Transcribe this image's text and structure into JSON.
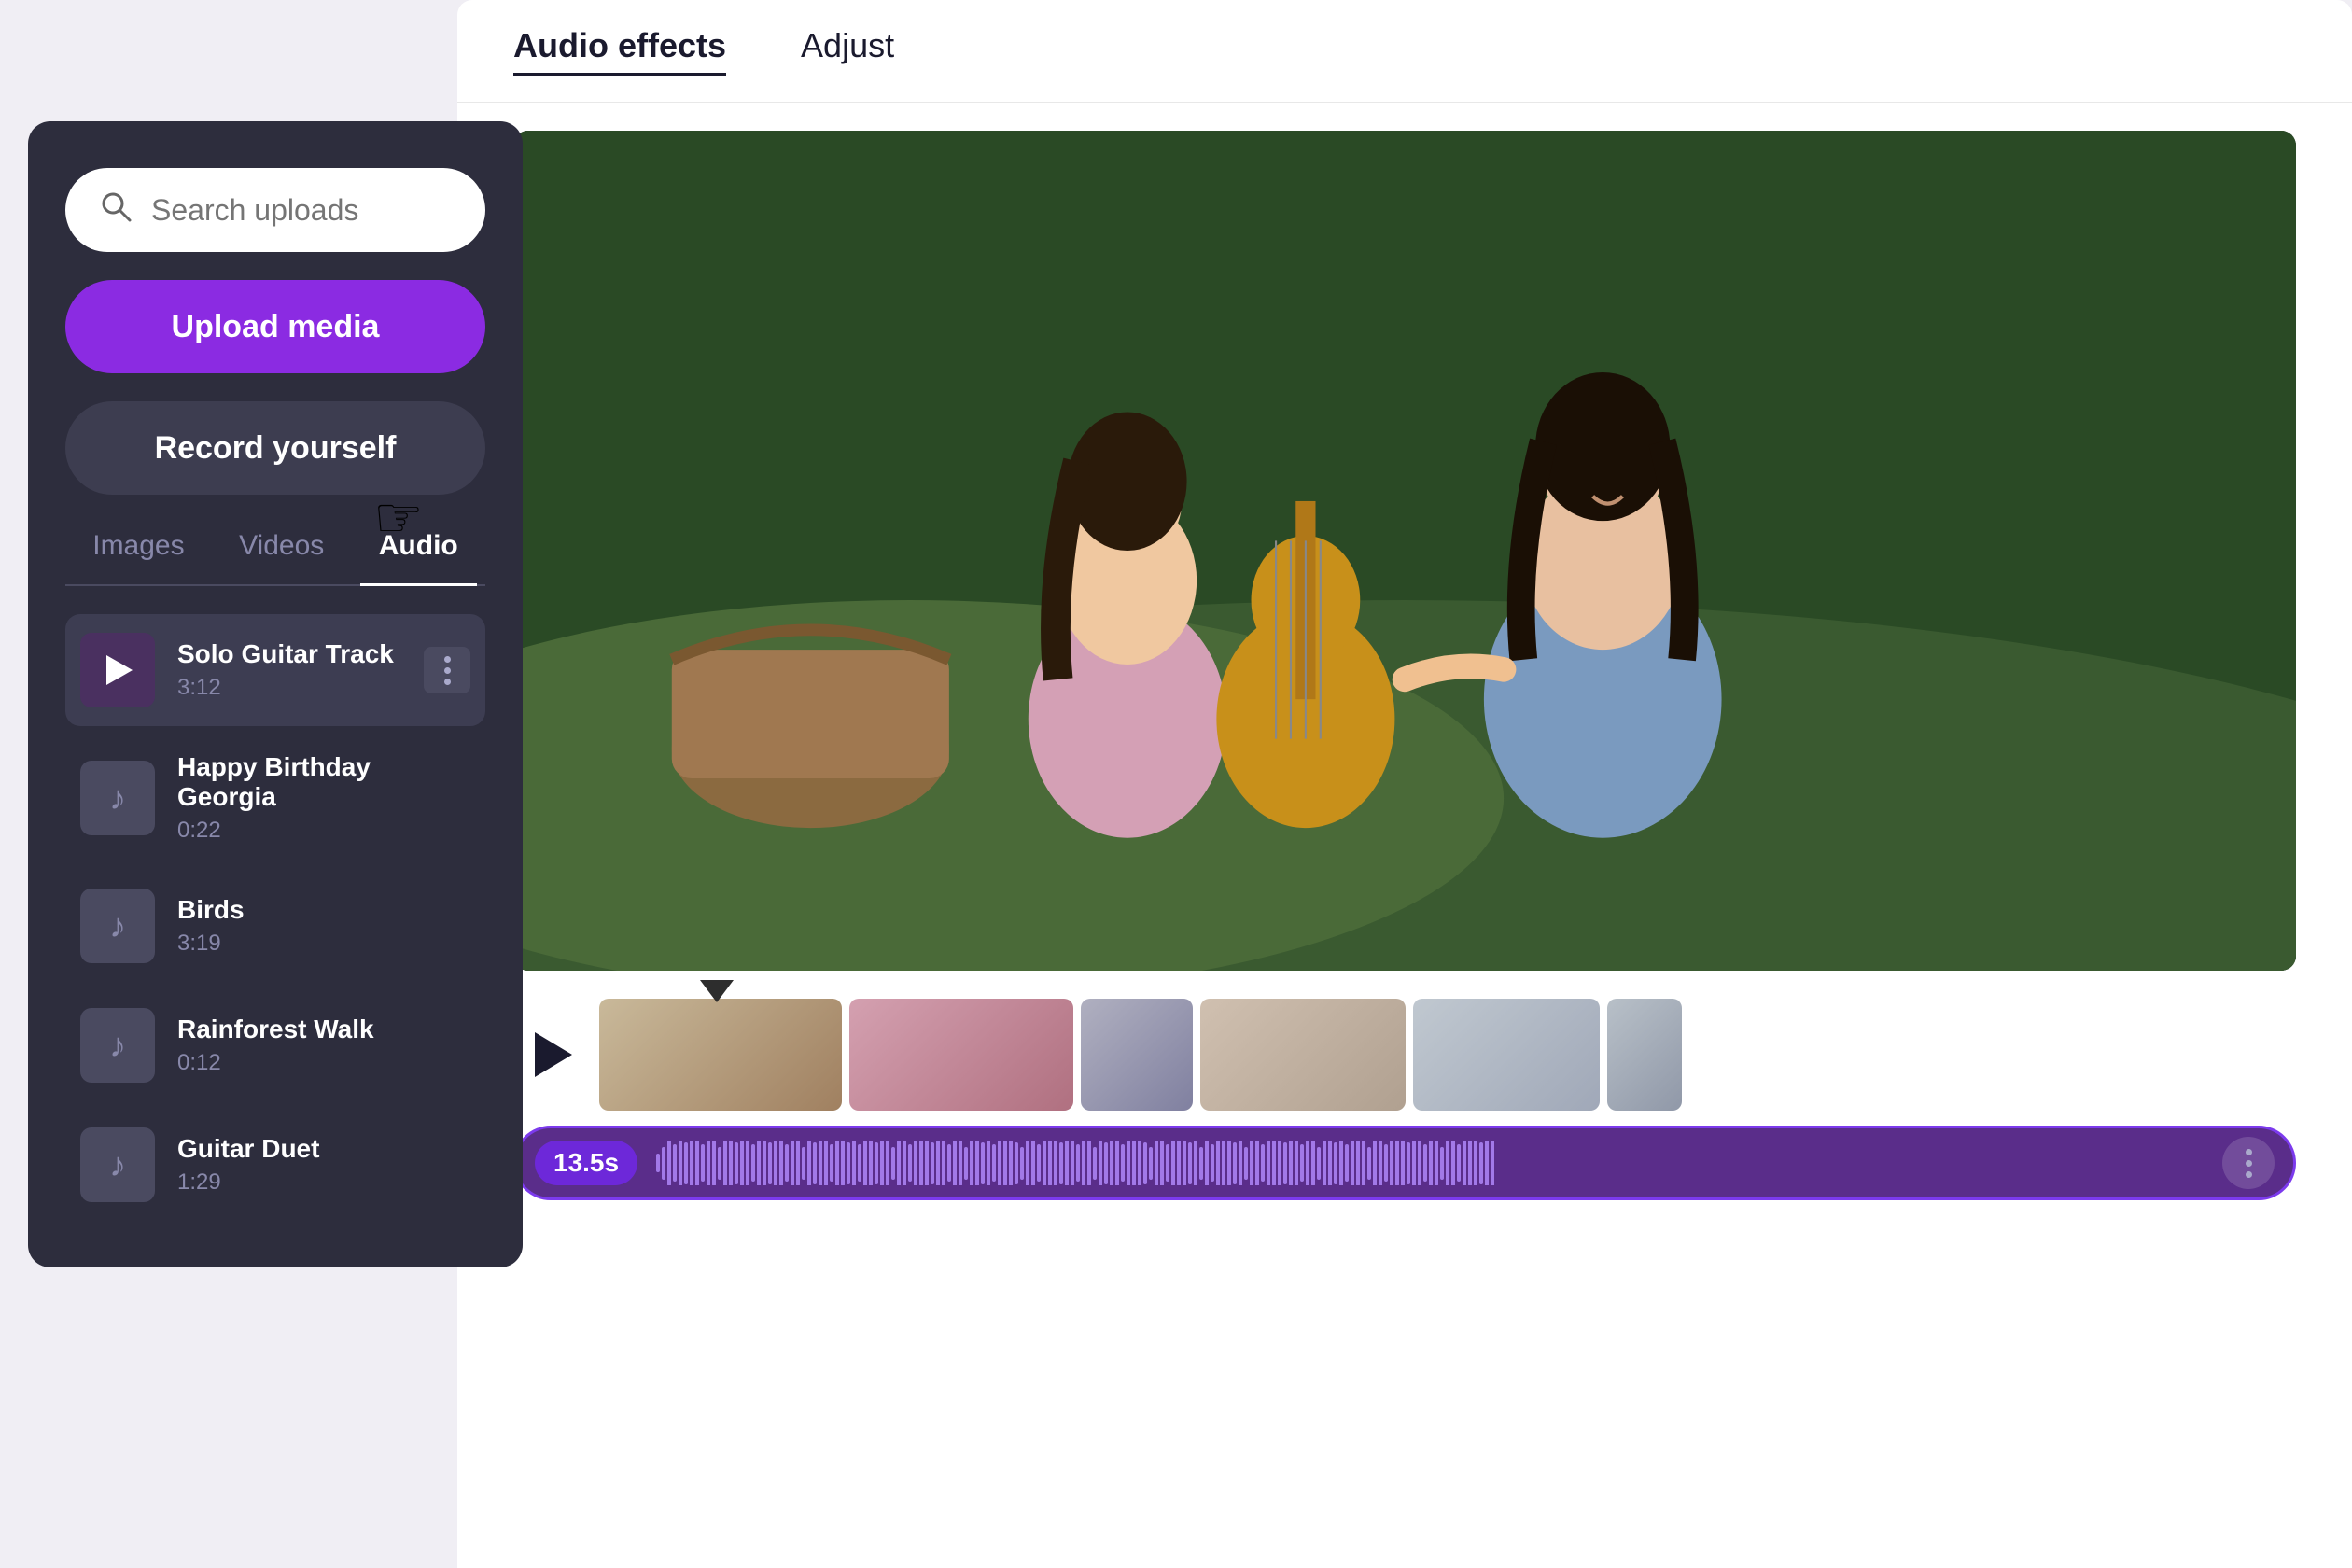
{
  "tabs": {
    "audio_effects": "Audio effects",
    "adjust": "Adjust",
    "active": "audio_effects"
  },
  "search": {
    "placeholder": "Search uploads"
  },
  "buttons": {
    "upload_media": "Upload media",
    "record_yourself": "Record yourself"
  },
  "media_tabs": [
    {
      "id": "images",
      "label": "Images"
    },
    {
      "id": "videos",
      "label": "Videos"
    },
    {
      "id": "audio",
      "label": "Audio",
      "active": true
    }
  ],
  "audio_items": [
    {
      "id": "solo-guitar",
      "title": "Solo Guitar Track",
      "duration": "3:12",
      "selected": true
    },
    {
      "id": "happy-birthday",
      "title": "Happy Birthday Georgia",
      "duration": "0:22",
      "selected": false
    },
    {
      "id": "birds",
      "title": "Birds",
      "duration": "3:19",
      "selected": false
    },
    {
      "id": "rainforest-walk",
      "title": "Rainforest Walk",
      "duration": "0:12",
      "selected": false
    },
    {
      "id": "guitar-duet",
      "title": "Guitar Duet",
      "duration": "1:29",
      "selected": false
    }
  ],
  "timeline": {
    "timestamp": "13.5s",
    "dots_label": "⋯"
  },
  "colors": {
    "upload_btn_bg": "#8b2be2",
    "record_btn_bg": "#3d3d50",
    "panel_bg": "#2d2d3d",
    "audio_track_bg": "#5a2d8a",
    "audio_track_border": "#7c3aed",
    "selected_item_bg": "#3d3d52"
  }
}
